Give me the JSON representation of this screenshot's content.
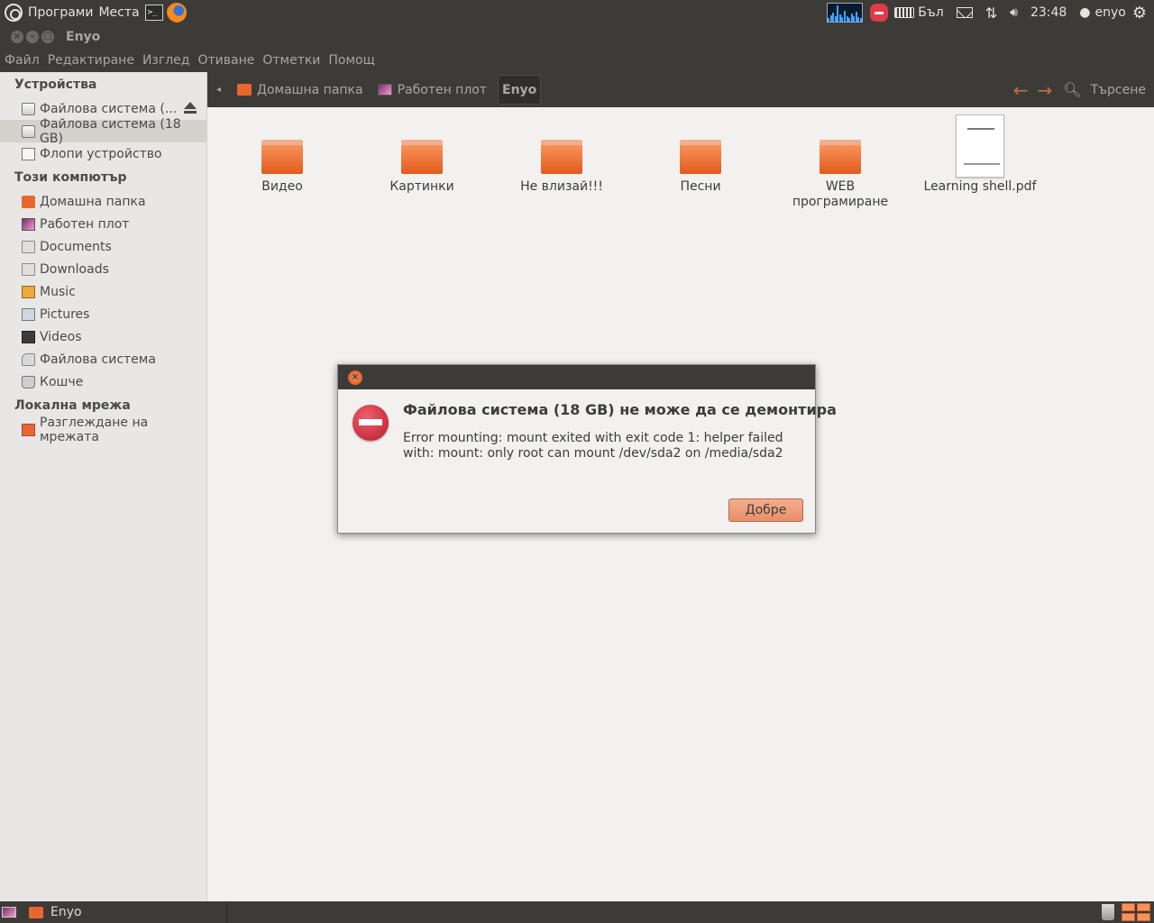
{
  "top_panel": {
    "menus": [
      "Програми",
      "Места"
    ],
    "keyboard_layout": "Бъл",
    "clock": "23:48",
    "user": "enyo",
    "sysmon_levels": [
      0.2,
      0.35,
      0.5,
      0.3,
      0.9,
      0.4,
      0.25,
      0.6,
      0.3,
      0.2,
      0.45,
      0.3,
      0.55,
      0.25,
      0.2
    ]
  },
  "window": {
    "title": "Enyo",
    "menu": [
      "Файл",
      "Редактиране",
      "Изглед",
      "Отиване",
      "Отметки",
      "Помощ"
    ]
  },
  "sidebar": {
    "sections": [
      {
        "title": "Устройства",
        "items": [
          {
            "label": "Файлова система (...",
            "icon": "drive-icon",
            "eject": true
          },
          {
            "label": "Файлова система (18 GB)",
            "icon": "drive-icon",
            "selected": true
          },
          {
            "label": "Флопи устройство",
            "icon": "floppy-icon"
          }
        ]
      },
      {
        "title": "Този компютър",
        "items": [
          {
            "label": "Домашна папка",
            "icon": "home-icon"
          },
          {
            "label": "Работен плот",
            "icon": "desktop-icon"
          },
          {
            "label": "Documents",
            "icon": "folder-icon"
          },
          {
            "label": "Downloads",
            "icon": "folder-icon"
          },
          {
            "label": "Music",
            "icon": "music-icon"
          },
          {
            "label": "Pictures",
            "icon": "pictures-icon"
          },
          {
            "label": "Videos",
            "icon": "videos-icon"
          },
          {
            "label": "Файлова система",
            "icon": "filesystem-icon"
          },
          {
            "label": "Кошче",
            "icon": "trash-icon"
          }
        ]
      },
      {
        "title": "Локална мрежа",
        "items": [
          {
            "label": "Разглеждане на мрежата",
            "icon": "network-icon"
          }
        ]
      }
    ]
  },
  "toolbar": {
    "breadcrumbs": [
      {
        "label": "Домашна папка",
        "icon": "home-icon"
      },
      {
        "label": "Работен плот",
        "icon": "desktop-icon"
      },
      {
        "label": "Enyo",
        "current": true
      }
    ],
    "search_label": "Търсене"
  },
  "files": [
    {
      "name": "Видео",
      "type": "folder"
    },
    {
      "name": "Картинки",
      "type": "folder"
    },
    {
      "name": "Не влизай!!!",
      "type": "folder"
    },
    {
      "name": "Песни",
      "type": "folder"
    },
    {
      "name": "WEB програмиране",
      "type": "folder"
    },
    {
      "name": "Learning shell.pdf",
      "type": "pdf"
    }
  ],
  "dialog": {
    "heading": "Файлова система (18 GB) не може да се демонтира",
    "message": "Error mounting: mount exited with exit code 1: helper failed with: mount: only root can mount /dev/sda2 on /media/sda2",
    "ok_label": "Добре"
  },
  "taskbar": {
    "task_label": "Enyo"
  },
  "colors": {
    "panel": "#3c3b37",
    "accent": "#e9672f",
    "error": "#c7162b"
  }
}
